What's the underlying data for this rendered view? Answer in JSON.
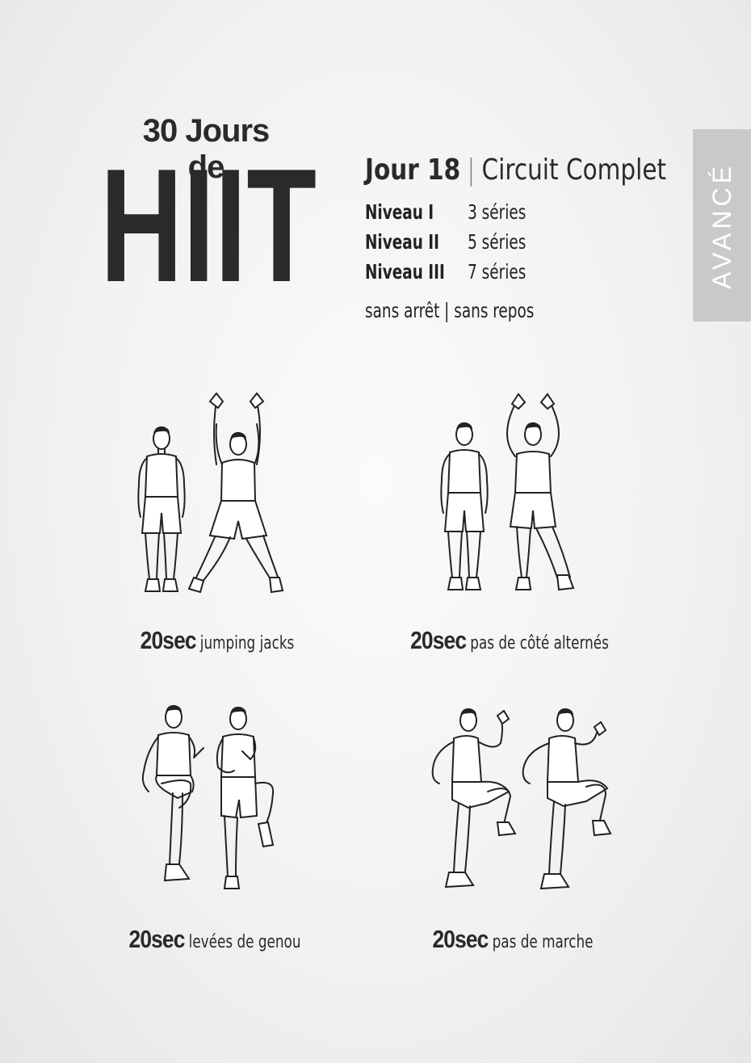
{
  "header": {
    "title_small": "30 Jours de",
    "title_big": "HIIT",
    "day": "Jour 18",
    "separator": "|",
    "circuit": "Circuit Complet",
    "levels": [
      {
        "name": "Niveau I",
        "sets": "3 séries"
      },
      {
        "name": "Niveau II",
        "sets": "5 séries"
      },
      {
        "name": "Niveau III",
        "sets": "7 séries"
      }
    ],
    "note": "sans arrêt | sans repos",
    "badge": "AVANCÉ"
  },
  "exercises": [
    {
      "duration": "20sec",
      "name": "jumping jacks"
    },
    {
      "duration": "20sec",
      "name": "pas de côté alternés"
    },
    {
      "duration": "20sec",
      "name": "levées de genou"
    },
    {
      "duration": "20sec",
      "name": "pas de marche"
    }
  ],
  "colors": {
    "text": "#222222",
    "badge": "#c9c9c9",
    "background": "#f1f1f1"
  }
}
